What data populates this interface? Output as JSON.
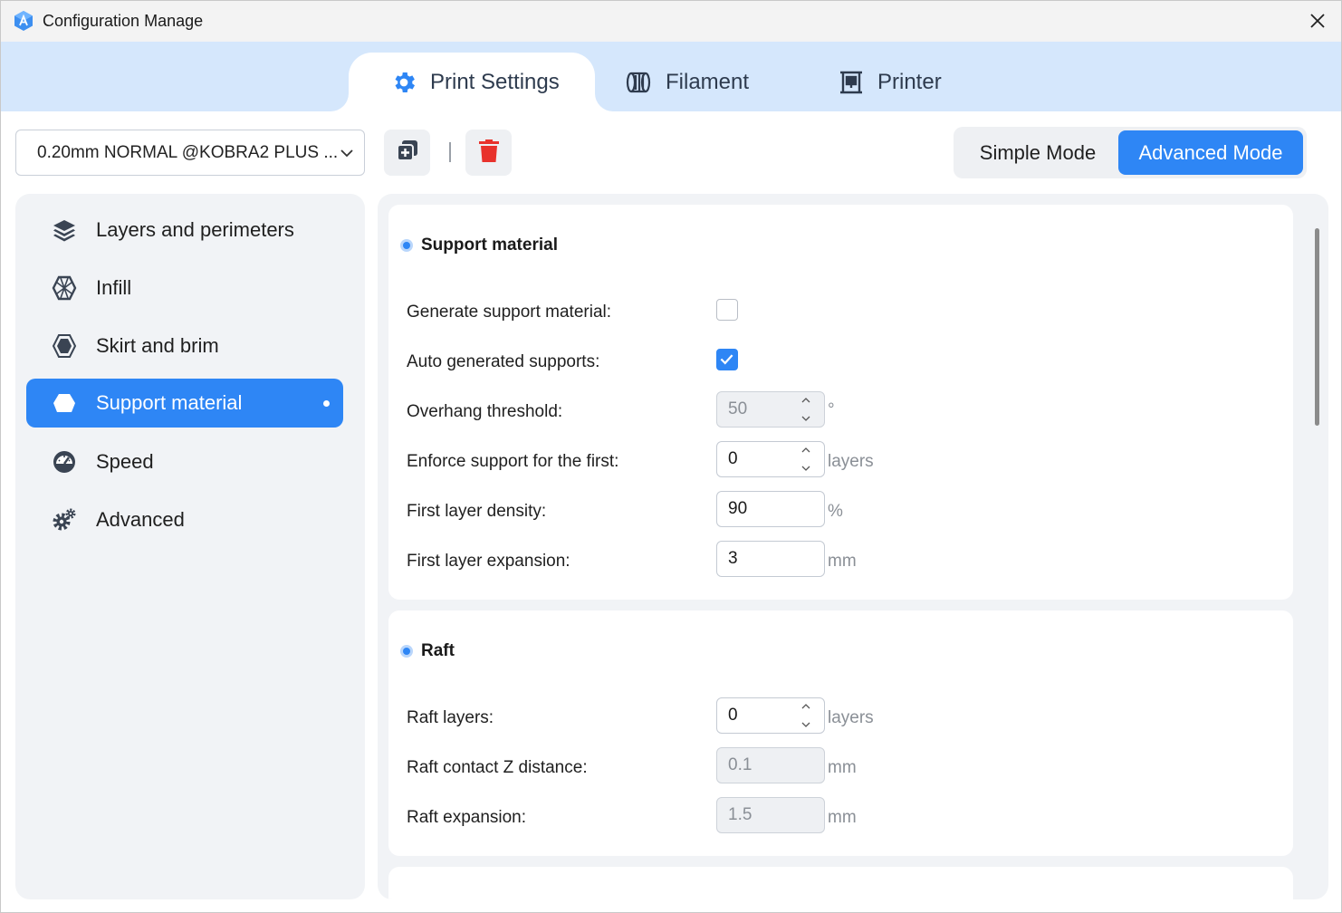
{
  "window": {
    "title": "Configuration Manage",
    "logo_icon": "anycubic-logo-icon",
    "close_icon": "close-icon"
  },
  "tabs": [
    {
      "label": "Print Settings",
      "icon": "gear-icon",
      "active": true
    },
    {
      "label": "Filament",
      "icon": "filament-spool-icon",
      "active": false
    },
    {
      "label": "Printer",
      "icon": "printer-icon",
      "active": false
    }
  ],
  "toolbar": {
    "preset_value": "0.20mm NORMAL @KOBRA2 PLUS ...",
    "copy_icon": "copy-icon",
    "delete_icon": "trash-icon",
    "simple_mode_label": "Simple Mode",
    "advanced_mode_label": "Advanced Mode",
    "selected_mode": "Advanced Mode"
  },
  "sidebar": {
    "items": [
      {
        "label": "Layers and perimeters",
        "icon": "layers-icon"
      },
      {
        "label": "Infill",
        "icon": "infill-icon"
      },
      {
        "label": "Skirt and brim",
        "icon": "skirt-brim-icon"
      },
      {
        "label": "Support material",
        "icon": "support-icon",
        "active": true
      },
      {
        "label": "Speed",
        "icon": "speedometer-icon"
      },
      {
        "label": "Advanced",
        "icon": "advanced-gears-icon"
      }
    ]
  },
  "support_section": {
    "title": "Support material",
    "rows": [
      {
        "label": "Generate support material:",
        "type": "checkbox",
        "checked": false
      },
      {
        "label": "Auto generated supports:",
        "type": "checkbox",
        "checked": true
      },
      {
        "label": "Overhang threshold:",
        "type": "spin",
        "value": "50",
        "unit": "°",
        "disabled": true
      },
      {
        "label": "Enforce support for the first:",
        "type": "spin",
        "value": "0",
        "unit": "layers",
        "disabled": false
      },
      {
        "label": "First layer density:",
        "type": "text",
        "value": "90",
        "unit": "%",
        "disabled": false
      },
      {
        "label": "First layer expansion:",
        "type": "text",
        "value": "3",
        "unit": "mm",
        "disabled": false
      }
    ]
  },
  "raft_section": {
    "title": "Raft",
    "rows": [
      {
        "label": "Raft layers:",
        "type": "spin",
        "value": "0",
        "unit": "layers",
        "disabled": false
      },
      {
        "label": "Raft contact Z distance:",
        "type": "text",
        "value": "0.1",
        "unit": "mm",
        "disabled": true
      },
      {
        "label": "Raft expansion:",
        "type": "text",
        "value": "1.5",
        "unit": "mm",
        "disabled": true
      }
    ]
  },
  "colors": {
    "accent": "#2e86f5",
    "tab_band": "#d5e7fc",
    "panel_bg": "#f1f3f6",
    "delete_red": "#e8322c"
  }
}
